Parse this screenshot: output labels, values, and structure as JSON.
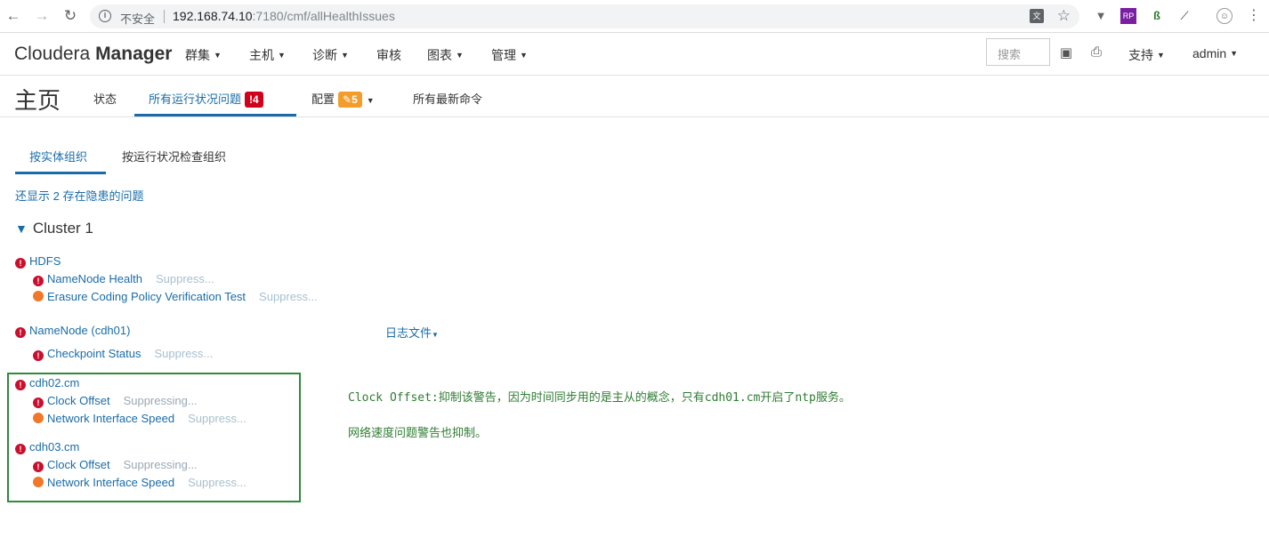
{
  "browser": {
    "insecure_label": "不安全",
    "url_host": "192.168.74.10",
    "url_rest": ":7180/cmf/allHealthIssues"
  },
  "header": {
    "brand_light": "Cloudera ",
    "brand_bold": "Manager",
    "menu": [
      "群集",
      "主机",
      "诊断",
      "审核",
      "图表",
      "管理"
    ],
    "search_placeholder": "搜索",
    "support_label": "支持",
    "user_label": "admin"
  },
  "page": {
    "title": "主页",
    "tabs": {
      "status": "状态",
      "health_issues": "所有运行状况问题",
      "health_issues_count": "4",
      "config": "配置",
      "config_count": "5",
      "commands": "所有最新命令"
    }
  },
  "subtabs": {
    "by_entity": "按实体组织",
    "by_check": "按运行状况检查组织"
  },
  "hidden_link": "还显示 2 存在隐患的问题",
  "cluster": {
    "name": "Cluster 1"
  },
  "groups": {
    "hdfs": {
      "name": "HDFS",
      "issues": [
        {
          "label": "NameNode Health",
          "action": "Suppress..."
        },
        {
          "label": "Erasure Coding Policy Verification Test",
          "action": "Suppress..."
        }
      ]
    },
    "namenode": {
      "name": "NameNode (cdh01)",
      "log_link": "日志文件",
      "issues": [
        {
          "label": "Checkpoint Status",
          "action": "Suppress..."
        }
      ]
    },
    "cdh02": {
      "name": "cdh02.cm",
      "issues": [
        {
          "label": "Clock Offset",
          "action": "Suppressing..."
        },
        {
          "label": "Network Interface Speed",
          "action": "Suppress..."
        }
      ]
    },
    "cdh03": {
      "name": "cdh03.cm",
      "issues": [
        {
          "label": "Clock Offset",
          "action": "Suppressing..."
        },
        {
          "label": "Network Interface Speed",
          "action": "Suppress..."
        }
      ]
    }
  },
  "notes": {
    "line1": "Clock Offset:抑制该警告，因为时间同步用的是主从的概念，只有cdh01.cm开启了ntp服务。",
    "line2": "网络速度问题警告也抑制。"
  },
  "colors": {
    "link": "#1a6ca8",
    "error": "#c8102e",
    "warning": "#f07828",
    "annotation": "#2e8b3a"
  }
}
